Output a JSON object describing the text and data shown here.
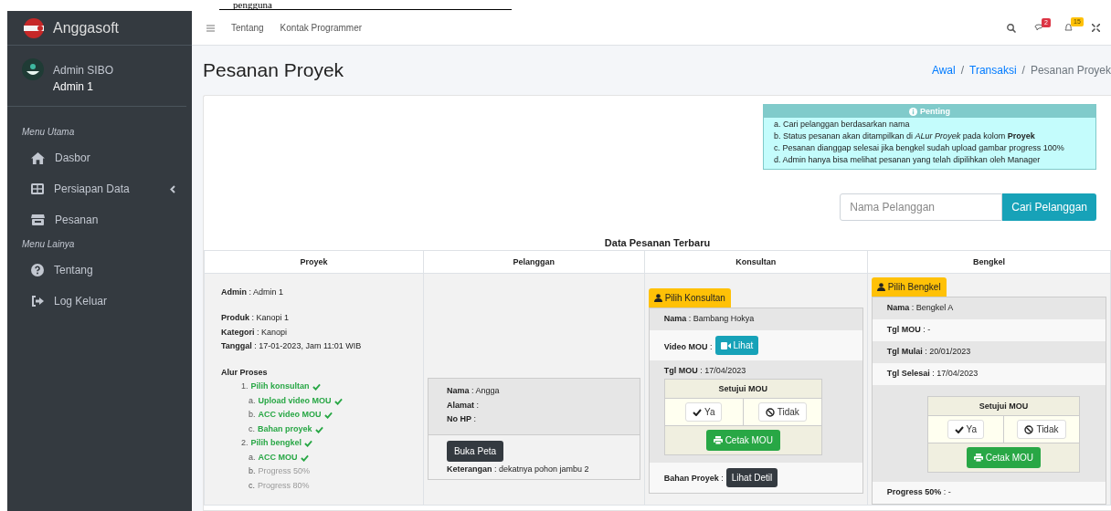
{
  "doc_caption": "pengguna",
  "brand": {
    "name": "Anggasoft"
  },
  "user": {
    "name": "Admin SIBO",
    "role": "Admin 1"
  },
  "sidebar": {
    "sections": [
      {
        "header": "Menu Utama",
        "items": [
          {
            "label": "Dasbor",
            "selected": false,
            "expandable": false
          },
          {
            "label": "Persiapan Data",
            "selected": false,
            "expandable": true
          },
          {
            "label": "Pesanan",
            "selected": false,
            "expandable": false
          }
        ]
      },
      {
        "header": "Menu Lainya",
        "items": [
          {
            "label": "Tentang",
            "selected": false,
            "expandable": false
          },
          {
            "label": "Log Keluar",
            "selected": false,
            "expandable": false
          }
        ]
      }
    ]
  },
  "navbar": {
    "links": [
      "Tentang",
      "Kontak Programmer"
    ],
    "messages_badge": "2",
    "notifications_badge": "15"
  },
  "page_title": "Pesanan Proyek",
  "breadcrumb": {
    "separator": "/",
    "items": [
      {
        "label": "Awal",
        "link": true
      },
      {
        "label": "Transaksi",
        "link": true
      },
      {
        "label": "Pesanan Proyek",
        "link": false
      }
    ]
  },
  "notice": {
    "title": "Penting",
    "items": [
      "a. Cari pelanggan berdasarkan nama",
      "b. Status pesanan akan ditampilkan di *ALur Proyek* pada kolom **Proyek**",
      "c. Pesanan dianggap selesai jika bengkel sudah upload gambar progress 100%",
      "d. Admin hanya bisa melihat pesanan yang telah dipilihkan oleh Manager"
    ]
  },
  "search": {
    "placeholder": "Nama Pelanggan",
    "button": "Cari Pelanggan"
  },
  "table": {
    "title": "Data Pesanan Terbaru",
    "columns": [
      "Proyek",
      "Pelanggan",
      "Konsultan",
      "Bengkel"
    ],
    "rows": [
      {
        "proyek": {
          "groups": [
            [
              "**Admin** : Admin 1"
            ],
            [
              "**Produk** : Kanopi 1",
              "**Kategori** : Kanopi",
              "**Tanggal** : 17-01-2023, Jam 11:01 WIB"
            ]
          ],
          "process_title": "Alur Proses",
          "steps": [
            {
              "marker": "1.",
              "label": "Pilih konsultan",
              "done": true,
              "children": [
                {
                  "marker": "a.",
                  "label": "Upload video MOU",
                  "done": true
                },
                {
                  "marker": "b.",
                  "label": "ACC video MOU",
                  "done": true
                },
                {
                  "marker": "c.",
                  "label": "Bahan proyek",
                  "done": true
                }
              ]
            },
            {
              "marker": "2.",
              "label": "Pilih bengkel",
              "done": true,
              "children": [
                {
                  "marker": "a.",
                  "label": "ACC MOU",
                  "done": true
                },
                {
                  "marker": "b.",
                  "label": "Progress 50%",
                  "done": false
                },
                {
                  "marker": "c.",
                  "label": "Progress 80%",
                  "done": false
                }
              ]
            }
          ]
        },
        "pelanggan": {
          "fields": [
            "**Nama** : Angga",
            "**Alamat** :",
            "**No HP** :"
          ],
          "button": "Buka Peta",
          "note": "**Keterangan** : dekatnya pohon jambu 2"
        },
        "konsultan": {
          "button": "Pilih Konsultan",
          "rows": [
            {
              "text": "**Nama** : Bambang Hokya"
            },
            {
              "text": "**Video MOU** :",
              "button": {
                "text": "Lihat",
                "kind": "video"
              }
            },
            {
              "text": "**Tgl MOU** : 17/04/2023",
              "approval": {
                "title": "Setujui MOU",
                "yes": "Ya",
                "no": "Tidak",
                "print": "Cetak MOU"
              }
            },
            {
              "text": "**Bahan Proyek** :",
              "button": {
                "text": "Lihat Detil",
                "kind": "detail"
              }
            }
          ]
        },
        "bengkel": {
          "button": "Pilih Bengkel",
          "rows": [
            {
              "text": "**Nama** : Bengkel A"
            },
            {
              "text": "**Tgl MOU** : -"
            },
            {
              "text": "**Tgl Mulai** : 20/01/2023"
            },
            {
              "text": "**Tgl Selesai** : 17/04/2023"
            },
            {
              "approval": {
                "title": "Setujui MOU",
                "yes": "Ya",
                "no": "Tidak",
                "print": "Cetak MOU"
              }
            },
            {
              "text": "**Progress 50%** : -"
            }
          ]
        }
      }
    ]
  }
}
